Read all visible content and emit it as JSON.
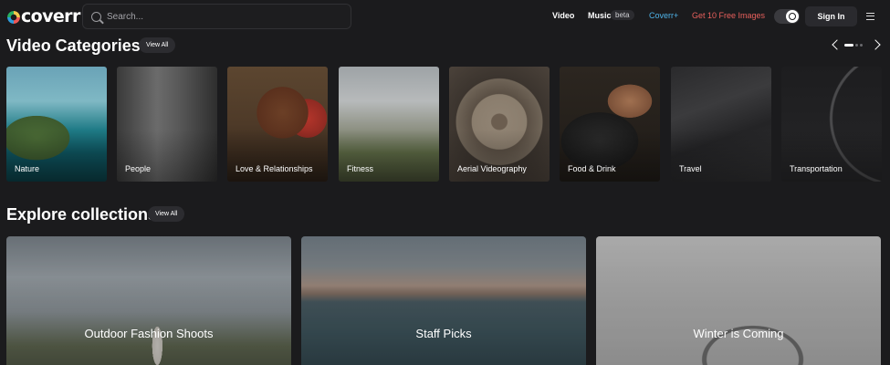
{
  "header": {
    "logo": "coverr",
    "search_placeholder": "Search...",
    "nav": {
      "video": "Video",
      "music": "Music",
      "beta": "beta",
      "coverr_plus": "Coverr+",
      "free_images": "Get 10 Free Images",
      "sign_in": "Sign In"
    },
    "colors": {
      "coverr_plus": "#4fb3e8",
      "free_images": "#e8605c"
    }
  },
  "video_categories": {
    "title": "Video Categories",
    "view_all": "View All",
    "items": [
      {
        "label": "Nature"
      },
      {
        "label": "People"
      },
      {
        "label": "Love & Relationships"
      },
      {
        "label": "Fitness"
      },
      {
        "label": "Aerial Videography"
      },
      {
        "label": "Food & Drink"
      },
      {
        "label": "Travel"
      },
      {
        "label": "Transportation"
      }
    ]
  },
  "collections": {
    "title": "Explore collections",
    "view_all": "View All",
    "items": [
      {
        "label": "Outdoor Fashion Shoots"
      },
      {
        "label": "Staff Picks"
      },
      {
        "label": "Winter is Coming"
      }
    ]
  },
  "icons": {
    "search": "search-icon",
    "theme_toggle": "theme-toggle-icon",
    "menu": "hamburger-menu-icon",
    "prev": "chevron-left-icon",
    "next": "chevron-right-icon"
  }
}
